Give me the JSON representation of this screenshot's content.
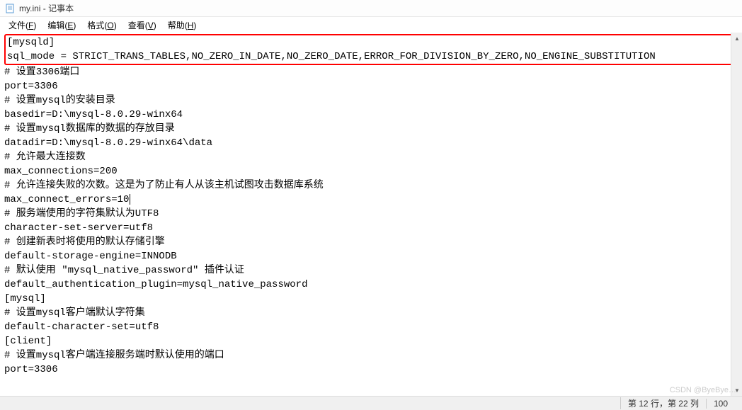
{
  "titlebar": {
    "title": "my.ini - 记事本"
  },
  "menubar": {
    "items": [
      {
        "label": "文件(",
        "key": "F",
        "close": ")"
      },
      {
        "label": "编辑(",
        "key": "E",
        "close": ")"
      },
      {
        "label": "格式(",
        "key": "O",
        "close": ")"
      },
      {
        "label": "查看(",
        "key": "V",
        "close": ")"
      },
      {
        "label": "帮助(",
        "key": "H",
        "close": ")"
      }
    ]
  },
  "content": {
    "highlighted": [
      "[mysqld]",
      "sql_mode = STRICT_TRANS_TABLES,NO_ZERO_IN_DATE,NO_ZERO_DATE,ERROR_FOR_DIVISION_BY_ZERO,NO_ENGINE_SUBSTITUTION"
    ],
    "lines": [
      "# 设置3306端口",
      "port=3306",
      "# 设置mysql的安装目录",
      "basedir=D:\\mysql-8.0.29-winx64",
      "# 设置mysql数据库的数据的存放目录",
      "datadir=D:\\mysql-8.0.29-winx64\\data",
      "# 允许最大连接数",
      "max_connections=200",
      "# 允许连接失败的次数。这是为了防止有人从该主机试图攻击数据库系统",
      "max_connect_errors=10",
      "# 服务端使用的字符集默认为UTF8",
      "character-set-server=utf8",
      "# 创建新表时将使用的默认存储引擎",
      "default-storage-engine=INNODB",
      "# 默认使用 \"mysql_native_password\" 插件认证",
      "default_authentication_plugin=mysql_native_password",
      "[mysql]",
      "# 设置mysql客户端默认字符集",
      "default-character-set=utf8",
      "[client]",
      "# 设置mysql客户端连接服务端时默认使用的端口",
      "port=3306"
    ],
    "cursor_line_index": 9
  },
  "statusbar": {
    "position": "第 12 行，第 22 列",
    "zoom": "100"
  },
  "watermark": "CSDN @ByeBye…"
}
